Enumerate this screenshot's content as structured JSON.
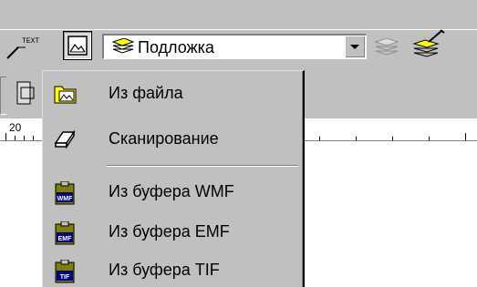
{
  "toolbar": {
    "text_tool_label": "TEXT",
    "layer_combo": {
      "selected": "Подложка"
    }
  },
  "ruler": {
    "label": "20"
  },
  "menu": {
    "items": [
      {
        "label": "Из файла",
        "icon": "folder-image-icon"
      },
      {
        "label": "Сканирование",
        "icon": "scanner-icon"
      },
      {
        "label": "Из буфера WMF",
        "icon": "clipboard-wmf-icon",
        "badge": "WMF"
      },
      {
        "label": "Из буфера EMF",
        "icon": "clipboard-emf-icon",
        "badge": "EMF"
      },
      {
        "label": "Из буфера TIF",
        "icon": "clipboard-tif-icon",
        "badge": "TIF"
      }
    ]
  },
  "colors": {
    "chrome": "#c0c0c0",
    "accent_yellow": "#ffff00",
    "badge_blue": "#000080"
  }
}
